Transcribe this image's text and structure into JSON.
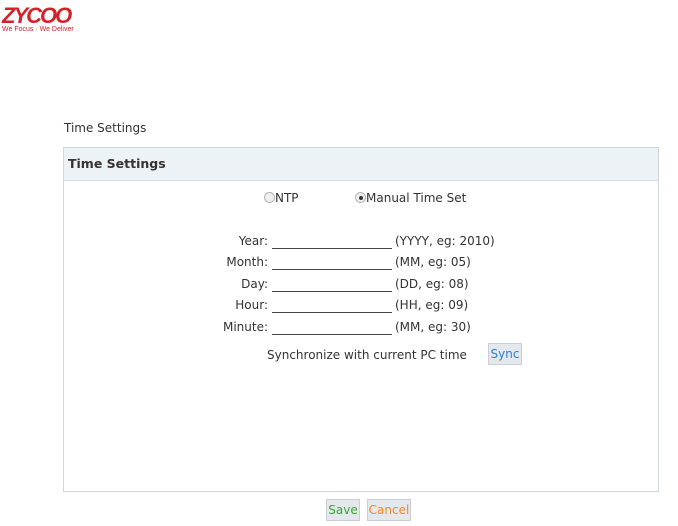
{
  "brand": {
    "logo_text": "ZYCOO",
    "tagline": "We Focus · We Deliver",
    "color": "#d2232a"
  },
  "page_title": "Time Settings",
  "panel": {
    "title": "Time Settings",
    "mode": {
      "options": [
        {
          "label": "NTP",
          "checked": false
        },
        {
          "label": "Manual Time Set",
          "checked": true
        }
      ]
    },
    "fields": [
      {
        "label": "Year:",
        "value": "",
        "hint": "(YYYY, eg: 2010)"
      },
      {
        "label": "Month:",
        "value": "",
        "hint": "(MM, eg: 05)"
      },
      {
        "label": "Day:",
        "value": "",
        "hint": "(DD, eg: 08)"
      },
      {
        "label": "Hour:",
        "value": "",
        "hint": "(HH, eg: 09)"
      },
      {
        "label": "Minute:",
        "value": "",
        "hint": "(MM, eg: 30)"
      }
    ],
    "sync": {
      "label": "Synchronize with current PC time",
      "button": "Sync"
    }
  },
  "actions": {
    "save": "Save",
    "cancel": "Cancel"
  },
  "colors": {
    "header_bg": "#edf2f6",
    "sync_text": "#2a7fd4",
    "save_text": "#3aa336",
    "cancel_text": "#f08a24"
  }
}
